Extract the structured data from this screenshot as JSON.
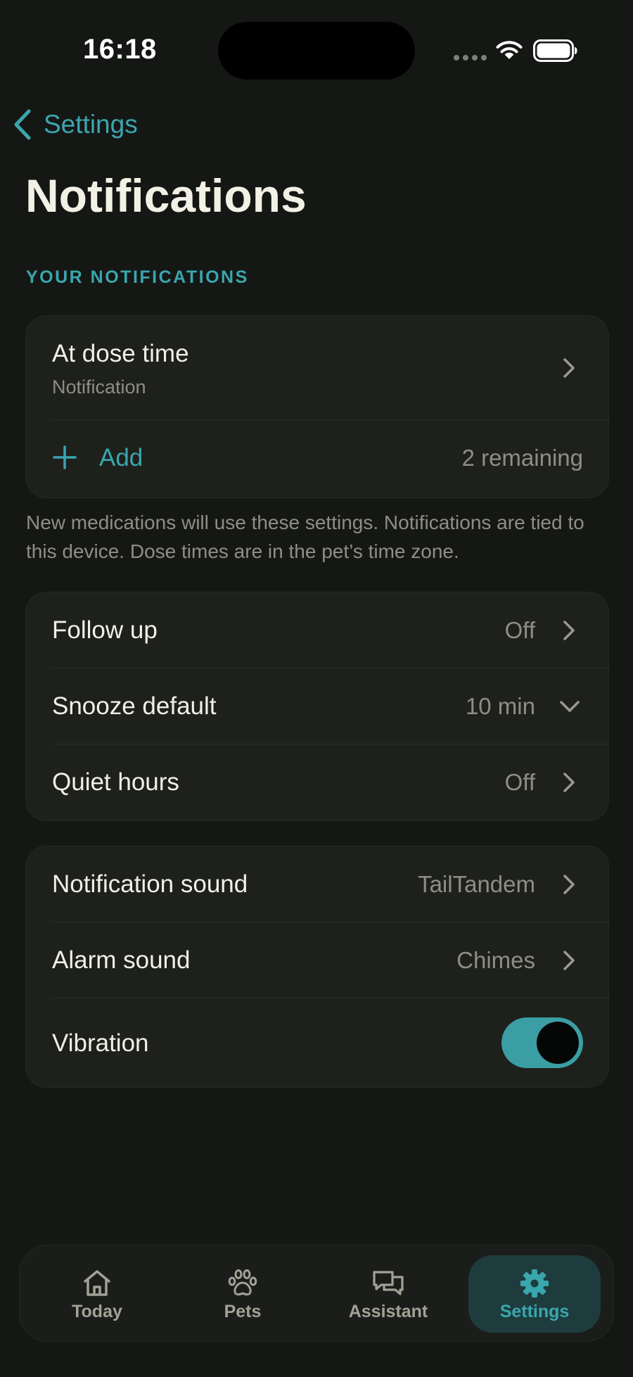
{
  "status_bar": {
    "time": "16:18"
  },
  "nav": {
    "back_label": "Settings"
  },
  "page": {
    "title": "Notifications",
    "section_header": "YOUR NOTIFICATIONS"
  },
  "notifications_card": {
    "item": {
      "label": "At dose time",
      "sublabel": "Notification"
    },
    "add_label": "Add",
    "remaining": "2 remaining"
  },
  "footnote": "New medications will use these settings. Notifications are tied to this device. Dose times are in the pet’s time zone.",
  "behavior_card": {
    "rows": [
      {
        "label": "Follow up",
        "value": "Off",
        "control": "chevron-right"
      },
      {
        "label": "Snooze default",
        "value": "10 min",
        "control": "chevron-down"
      },
      {
        "label": "Quiet hours",
        "value": "Off",
        "control": "chevron-right"
      }
    ]
  },
  "sound_card": {
    "rows": [
      {
        "label": "Notification sound",
        "value": "TailTandem",
        "control": "chevron-right"
      },
      {
        "label": "Alarm sound",
        "value": "Chimes",
        "control": "chevron-right"
      }
    ],
    "vibration": {
      "label": "Vibration",
      "enabled": true
    }
  },
  "tab_bar": {
    "tabs": [
      {
        "label": "Today",
        "icon": "home-icon",
        "active": false
      },
      {
        "label": "Pets",
        "icon": "paw-icon",
        "active": false
      },
      {
        "label": "Assistant",
        "icon": "chat-bubbles-icon",
        "active": false
      },
      {
        "label": "Settings",
        "icon": "gear-icon",
        "active": true
      }
    ]
  },
  "colors": {
    "background": "#151714",
    "card": "#1e201c",
    "accent": "#3aa6ae",
    "text_primary": "#f1efe6",
    "text_secondary": "#8f8e85",
    "toggle_on": "#3a9ea4",
    "active_tab_bg": "#1e3c3d"
  }
}
